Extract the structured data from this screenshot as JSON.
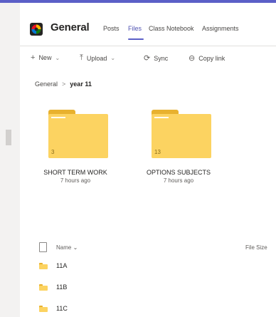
{
  "header": {
    "channel_name": "General",
    "tabs": [
      {
        "label": "Posts"
      },
      {
        "label": "Files"
      },
      {
        "label": "Class Notebook"
      },
      {
        "label": "Assignments"
      }
    ]
  },
  "toolbar": {
    "new_label": "New",
    "upload_label": "Upload",
    "sync_label": "Sync",
    "copy_link_label": "Copy link"
  },
  "breadcrumb": {
    "root": "General",
    "current": "year 11"
  },
  "tiles": [
    {
      "name": "SHORT TERM WORK",
      "modified": "7 hours ago",
      "count": "3"
    },
    {
      "name": "OPTIONS SUBJECTS",
      "modified": "7 hours ago",
      "count": "13"
    }
  ],
  "list": {
    "columns": {
      "name": "Name",
      "size": "File Size"
    },
    "rows": [
      {
        "name": "11A"
      },
      {
        "name": "11B"
      },
      {
        "name": "11C"
      }
    ]
  },
  "colors": {
    "accent": "#5b5fc7",
    "folder": "#fcd361"
  }
}
